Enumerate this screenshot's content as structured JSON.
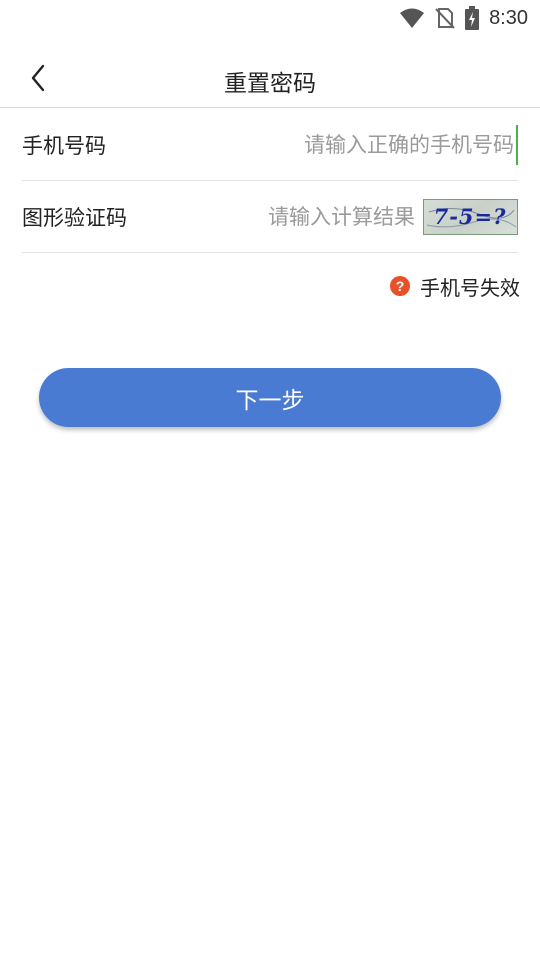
{
  "status_bar": {
    "time": "8:30",
    "icons": [
      "wifi-icon",
      "no-sim-icon",
      "battery-charging-icon"
    ]
  },
  "header": {
    "title": "重置密码",
    "back_icon": "chevron-left-icon"
  },
  "form": {
    "phone": {
      "label": "手机号码",
      "placeholder": "请输入正确的手机号码",
      "value": ""
    },
    "captcha": {
      "label": "图形验证码",
      "placeholder": "请输入计算结果",
      "value": "",
      "image_text": "7-5=?"
    }
  },
  "help": {
    "icon": "question-circle-icon",
    "icon_glyph": "?",
    "text": "手机号失效"
  },
  "actions": {
    "next_label": "下一步"
  },
  "colors": {
    "accent": "#4a7bd3",
    "help_icon": "#e8502a",
    "cursor": "#4caf50"
  }
}
